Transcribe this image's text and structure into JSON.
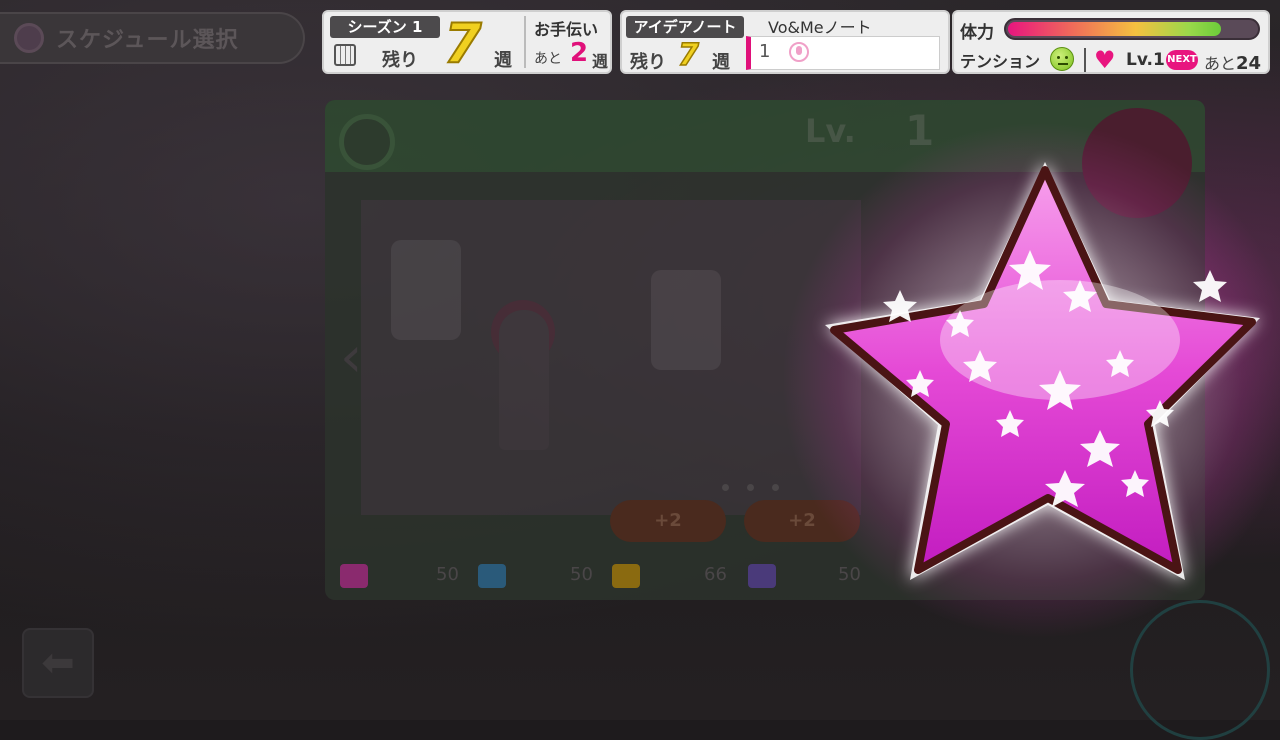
{
  "schedule": {
    "label": "スケジュール選択"
  },
  "season": {
    "title": "シーズン 1",
    "remain_label": "残り",
    "remain_weeks": "7",
    "week_label": "週",
    "helper_label": "お手伝い",
    "helper_rest": "あと",
    "helper_weeks": "2",
    "helper_week_label": "週"
  },
  "idea_note": {
    "title": "アイデアノート",
    "note_label": "Vo&Meノート",
    "remain_label": "残り",
    "remain_weeks": "7",
    "week_label": "週",
    "note_count": "1"
  },
  "stamina": {
    "label": "体力",
    "fill_fraction": 0.86,
    "tension_label": "テンション",
    "tension_icon": "smile-face-icon",
    "heart_level": "Lv.1",
    "next_label": "NEXT",
    "rest_label": "あと",
    "rest_value": "24"
  },
  "card": {
    "level_label": "Lv.",
    "level_value": "1",
    "bubbles": [
      "+2",
      "+2"
    ],
    "params": [
      {
        "value": "50",
        "color": "#8a2a6e"
      },
      {
        "value": "50",
        "color": "#2a5a7a"
      },
      {
        "value": "66",
        "color": "#8a6a10"
      },
      {
        "value": "50",
        "color": "#4a3a7a"
      }
    ]
  },
  "effects": {
    "star_color": "#e040d8",
    "star_border": "#4a1414"
  }
}
